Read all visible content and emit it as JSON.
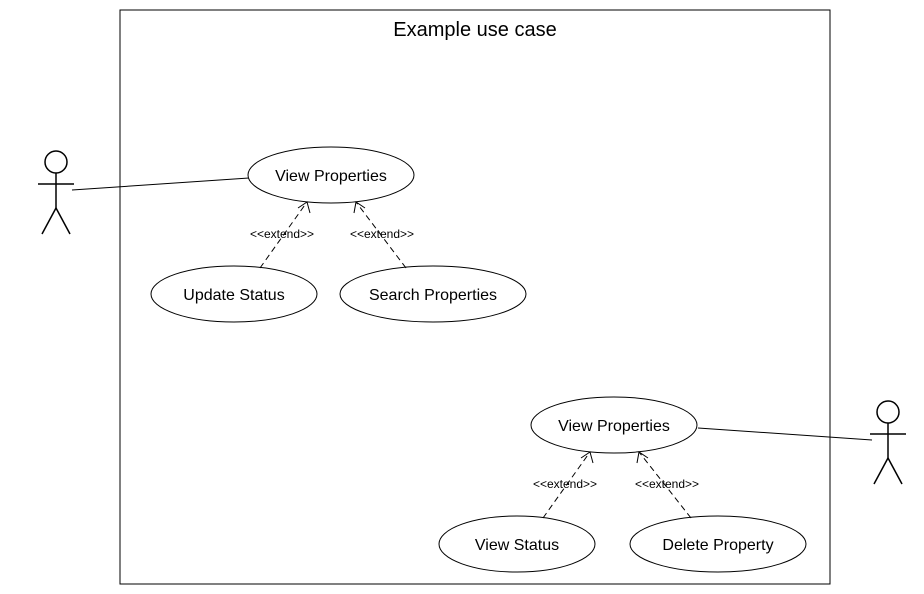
{
  "diagram": {
    "title": "Example use case",
    "stereotype": "<<extend>>",
    "cluster1": {
      "parent": "View Properties",
      "childLeft": "Update Status",
      "childRight": "Search Properties"
    },
    "cluster2": {
      "parent": "View Properties",
      "childLeft": "View Status",
      "childRight": "Delete Property"
    }
  }
}
